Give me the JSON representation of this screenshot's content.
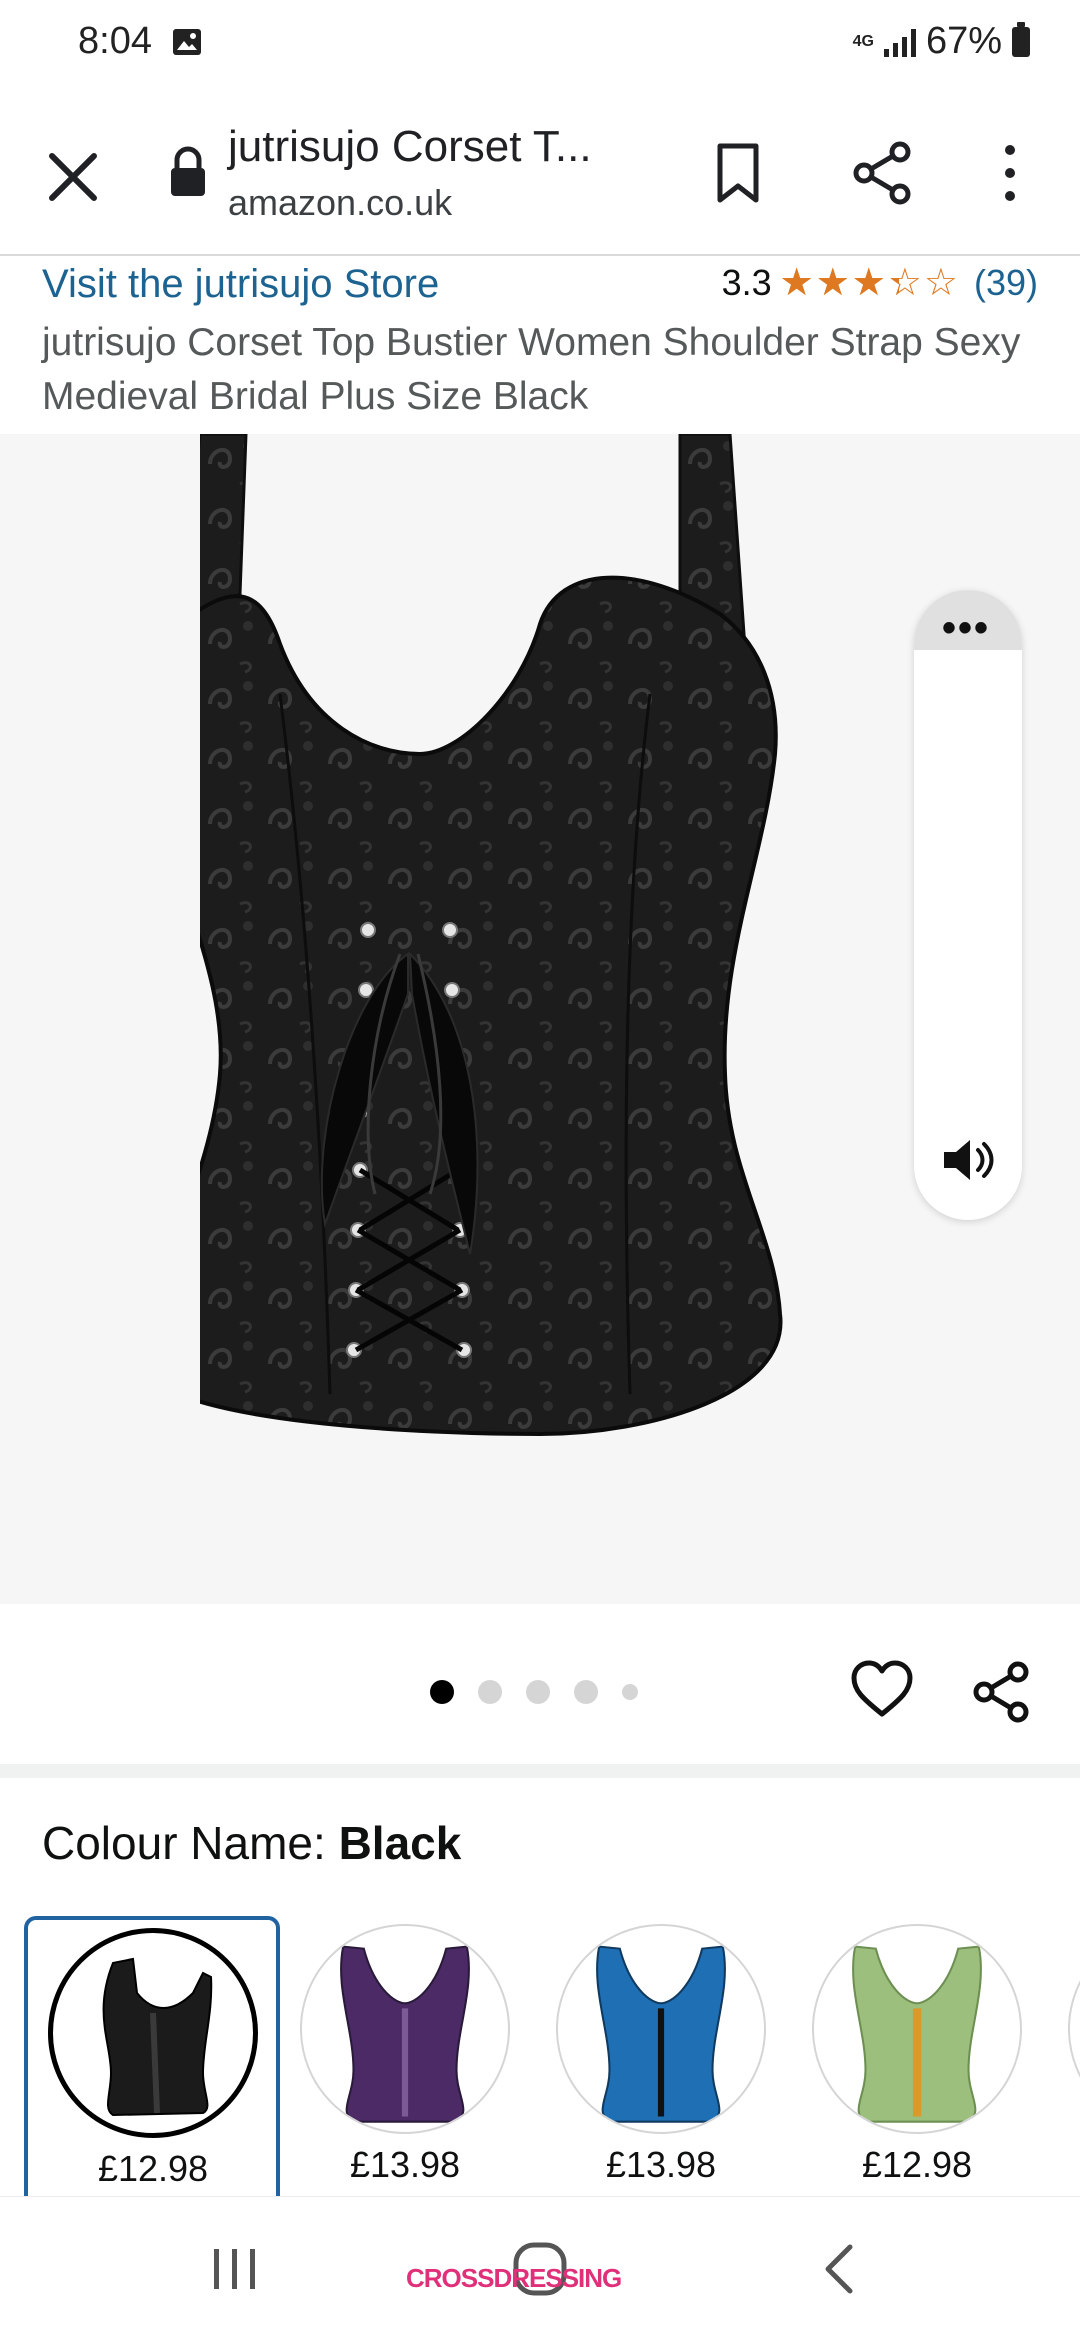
{
  "status_bar": {
    "time": "8:04",
    "network": "4G",
    "battery": "67%"
  },
  "browser": {
    "page_title": "jutrisujo Corset T...",
    "domain": "amazon.co.uk"
  },
  "product": {
    "store_link": "Visit the jutrisujo Store",
    "rating_value": "3.3",
    "rating_stars": 3.3,
    "rating_count": "(39)",
    "title": "jutrisujo Corset Top Bustier Women Shoulder Strap Sexy Medieval Bridal Plus Size Black"
  },
  "gallery": {
    "image_count": 5,
    "active_index": 0
  },
  "colour": {
    "label": "Colour Name:",
    "selected": "Black",
    "swatches": [
      {
        "price": "£12.98",
        "color": "#1b1b1b",
        "accent": "#3a3a3a"
      },
      {
        "price": "£13.98",
        "color": "#4b2a66",
        "accent": "#7b5a96"
      },
      {
        "price": "£13.98",
        "color": "#1f6fb5",
        "accent": "#4e9ad8"
      },
      {
        "price": "£12.98",
        "color": "#9cbf7e",
        "accent": "#c9dfb3"
      }
    ]
  },
  "watermark": "CROSSDRESSING",
  "colors": {
    "link": "#1c6391",
    "star": "#de7921",
    "selected_border": "#2162a1"
  }
}
